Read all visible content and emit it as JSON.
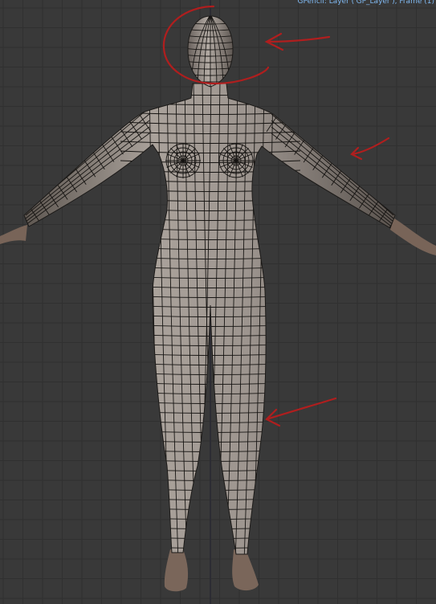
{
  "viewport": {
    "gpencil_info": "GPencil: Layer ('GP_Layer'), Frame (1)",
    "background_color": "#393939",
    "grid_color": "#303030",
    "grid_axis_color": "#2c2c33",
    "mesh_color": "#8e8680",
    "wire_color": "#161412",
    "skin_color": "#7d6a5f",
    "annotation_color": "#b02020"
  }
}
